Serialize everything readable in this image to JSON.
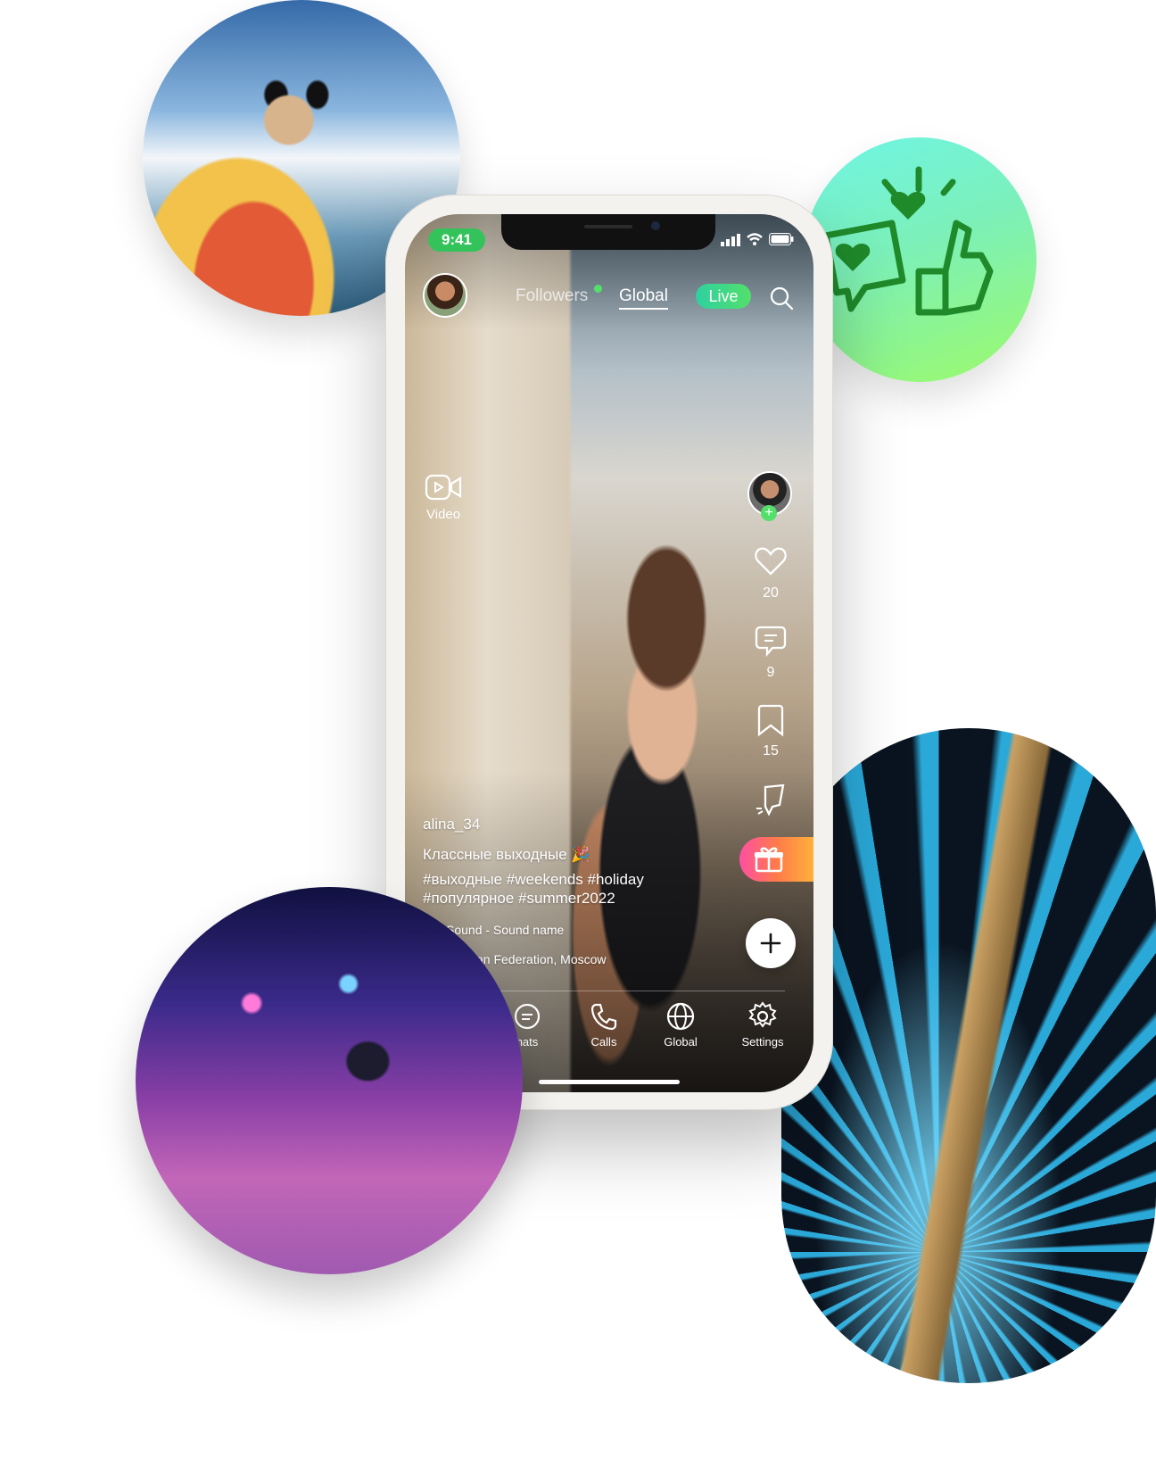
{
  "status_bar": {
    "time": "9:41"
  },
  "top_tabs": {
    "followers": "Followers",
    "global": "Global",
    "live": "Live"
  },
  "side_actions": {
    "video_label": "Video",
    "likes_count": "20",
    "comments_count": "9",
    "saves_count": "15"
  },
  "post": {
    "username": "alina_34",
    "title": "Классные выходные 🎉",
    "hashtags_line1": "#выходные #weekends #holiday",
    "hashtags_line2": "#популярное #summer2022",
    "sound": "Sound - Sound name",
    "location": "an Federation, Moscow"
  },
  "bottom_nav": {
    "chats": "hats",
    "calls": "Calls",
    "global": "Global",
    "settings": "Settings"
  },
  "colors": {
    "accent_green": "#34c35a",
    "live_gradient": [
      "#2fd0a0",
      "#52e06b"
    ],
    "gift_gradient": [
      "#ff4fa3",
      "#ff7a4a",
      "#ffb13b"
    ]
  }
}
